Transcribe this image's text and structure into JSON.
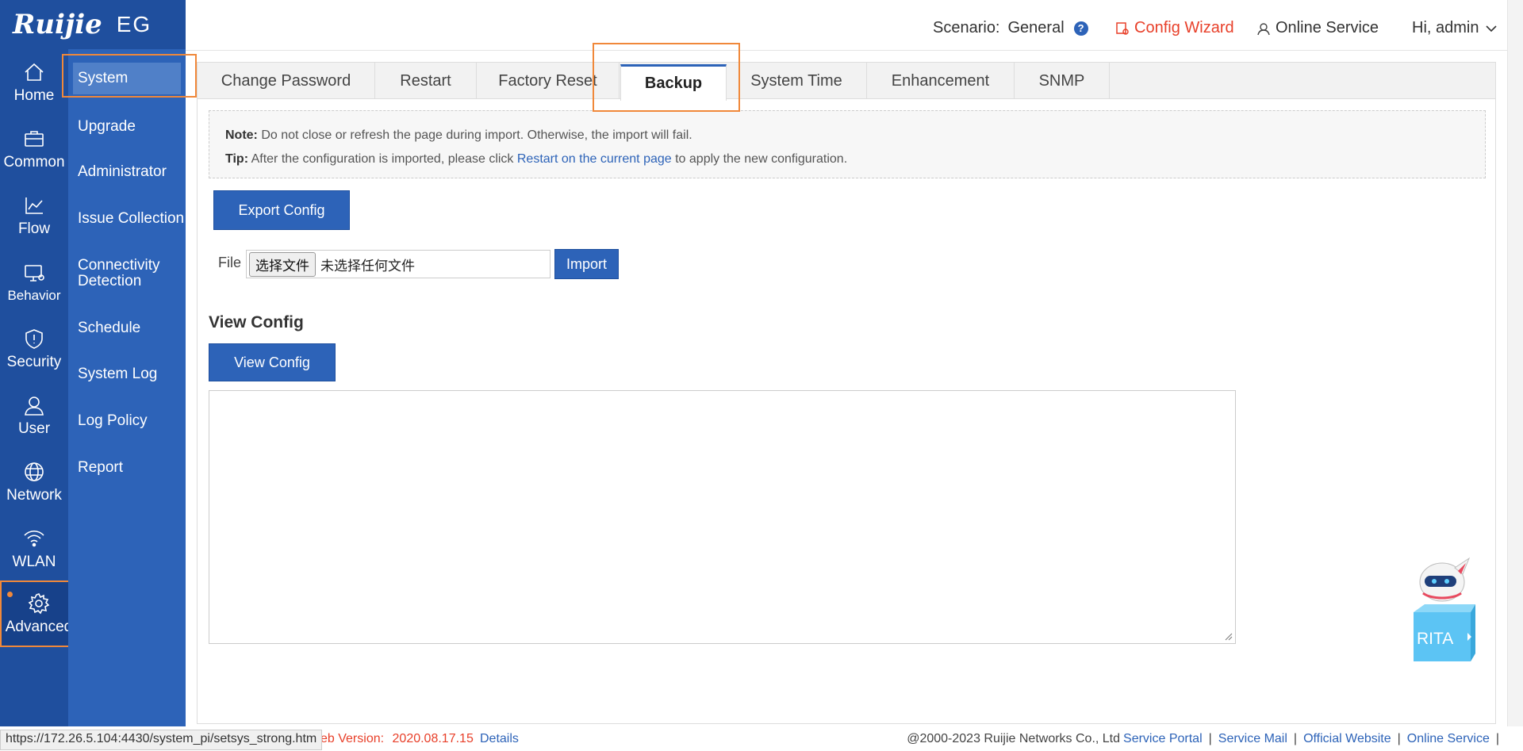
{
  "logo": {
    "brand": "Ruijie",
    "product": "EG"
  },
  "rail": [
    {
      "label": "Home",
      "icon": "home-icon"
    },
    {
      "label": "Common",
      "icon": "briefcase-icon"
    },
    {
      "label": "Flow",
      "icon": "line-chart-icon"
    },
    {
      "label": "Behavior",
      "icon": "monitor-icon"
    },
    {
      "label": "Security",
      "icon": "shield-icon"
    },
    {
      "label": "User",
      "icon": "user-icon"
    },
    {
      "label": "Network",
      "icon": "globe-icon"
    },
    {
      "label": "WLAN",
      "icon": "wifi-icon"
    },
    {
      "label": "Advanced",
      "icon": "gear-icon"
    }
  ],
  "subnav": [
    {
      "label": "System"
    },
    {
      "label": "Upgrade"
    },
    {
      "label": "Administrator"
    },
    {
      "label": "Issue Collection"
    },
    {
      "label": "Connectivity Detection"
    },
    {
      "label": "Schedule"
    },
    {
      "label": "System Log"
    },
    {
      "label": "Log Policy"
    },
    {
      "label": "Report"
    }
  ],
  "header": {
    "scenario_label": "Scenario:",
    "scenario_value": "General",
    "help": "?",
    "config_wizard": "Config Wizard",
    "online_service": "Online Service",
    "user": "Hi, admin"
  },
  "tabs": [
    {
      "label": "Change Password"
    },
    {
      "label": "Restart"
    },
    {
      "label": "Factory Reset"
    },
    {
      "label": "Backup"
    },
    {
      "label": "System Time"
    },
    {
      "label": "Enhancement"
    },
    {
      "label": "SNMP"
    }
  ],
  "note": {
    "note_label": "Note:",
    "note_text": " Do not close or refresh the page during import. Otherwise, the import will fail.",
    "tip_label": "Tip:",
    "tip_text_before": " After the configuration is imported, please click ",
    "tip_link": "Restart on the current page",
    "tip_text_after": "  to apply the new configuration."
  },
  "export_button": "Export Config",
  "file": {
    "label": "File",
    "choose": "选择文件",
    "status": "未选择任何文件",
    "import_button": "Import"
  },
  "view_config": {
    "heading": "View Config",
    "button": "View Config",
    "content": ""
  },
  "rita": {
    "label": "RITA"
  },
  "footer": {
    "url": "https://172.26.5.104:4430/system_pi/setsys_strong.htm",
    "web_version_label": "eb Version:",
    "web_version": "2020.08.17.15",
    "details": "Details",
    "copyright": "@2000-2023 Ruijie Networks Co., Ltd",
    "links": [
      "Service Portal",
      "Service Mail",
      "Official Website",
      "Online Service"
    ]
  },
  "colors": {
    "sidebar_dark": "#1f4f9e",
    "sidebar_sub": "#2d63b8",
    "accent": "#2d63b8",
    "highlight_frame": "#f0883a",
    "wizard_red": "#e8402a"
  }
}
